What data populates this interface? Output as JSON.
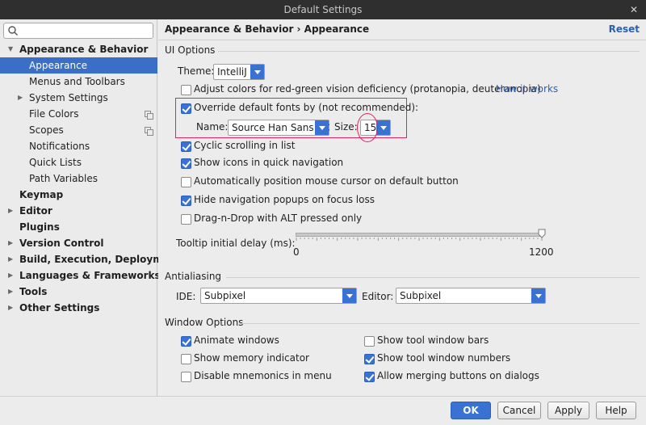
{
  "window": {
    "title": "Default Settings",
    "close_glyph": "✕"
  },
  "search": {
    "value": "",
    "placeholder": ""
  },
  "sidebar": {
    "items": [
      {
        "label": "Appearance & Behavior",
        "arrow": "▼",
        "bold": true
      },
      {
        "label": "Appearance"
      },
      {
        "label": "Menus and Toolbars"
      },
      {
        "label": "System Settings",
        "arrow": "▶"
      },
      {
        "label": "File Colors"
      },
      {
        "label": "Scopes"
      },
      {
        "label": "Notifications"
      },
      {
        "label": "Quick Lists"
      },
      {
        "label": "Path Variables"
      },
      {
        "label": "Keymap",
        "bold": true
      },
      {
        "label": "Editor",
        "arrow": "▶",
        "bold": true
      },
      {
        "label": "Plugins",
        "bold": true
      },
      {
        "label": "Version Control",
        "arrow": "▶",
        "bold": true
      },
      {
        "label": "Build, Execution, Deployment",
        "arrow": "▶",
        "bold": true
      },
      {
        "label": "Languages & Frameworks",
        "arrow": "▶",
        "bold": true
      },
      {
        "label": "Tools",
        "arrow": "▶",
        "bold": true
      },
      {
        "label": "Other Settings",
        "arrow": "▶",
        "bold": true
      }
    ]
  },
  "header": {
    "breadcrumb": "Appearance & Behavior › Appearance",
    "reset": "Reset"
  },
  "ui_options": {
    "section": "UI Options",
    "theme_label": "Theme:",
    "theme_value": "IntelliJ",
    "adjust_colors": {
      "label": "Adjust colors for red-green vision deficiency (protanopia, deuteranopia)",
      "checked": false
    },
    "how_it_works": "How it works",
    "override_fonts": {
      "label": "Override default fonts by (not recommended):",
      "checked": true
    },
    "name_label": "Name:",
    "font_name": "Source Han Sans SC",
    "size_label": "Size:",
    "font_size": "15",
    "cyclic_scrolling": {
      "label": "Cyclic scrolling in list",
      "checked": true
    },
    "show_icons": {
      "label": "Show icons in quick navigation",
      "checked": true
    },
    "auto_position": {
      "label": "Automatically position mouse cursor on default button",
      "checked": false
    },
    "hide_popups": {
      "label": "Hide navigation popups on focus loss",
      "checked": true
    },
    "drag_drop": {
      "label": "Drag-n-Drop with ALT pressed only",
      "checked": false
    },
    "tooltip_label": "Tooltip initial delay (ms):",
    "tooltip_min": "0",
    "tooltip_max": "1200",
    "tooltip_value_fraction": 1.0
  },
  "antialiasing": {
    "section": "Antialiasing",
    "ide_label": "IDE:",
    "ide_value": "Subpixel",
    "editor_label": "Editor:",
    "editor_value": "Subpixel"
  },
  "window_options": {
    "section": "Window Options",
    "animate_windows": {
      "label": "Animate windows",
      "checked": true
    },
    "show_memory": {
      "label": "Show memory indicator",
      "checked": false
    },
    "disable_mnemonics": {
      "label": "Disable mnemonics in menu",
      "checked": false
    },
    "show_tool_bars": {
      "label": "Show tool window bars",
      "checked": false
    },
    "show_tool_numbers": {
      "label": "Show tool window numbers",
      "checked": true
    },
    "allow_merging": {
      "label": "Allow merging buttons on dialogs",
      "checked": true
    }
  },
  "footer": {
    "ok": "OK",
    "cancel": "Cancel",
    "apply": "Apply",
    "help": "Help"
  },
  "colors": {
    "accent": "#3a72d4",
    "selection": "#3a6fc8",
    "link": "#2d5fb3",
    "highlight": "#e0245e"
  },
  "icons": {
    "search": "search-icon",
    "copy": "copy-icon"
  }
}
